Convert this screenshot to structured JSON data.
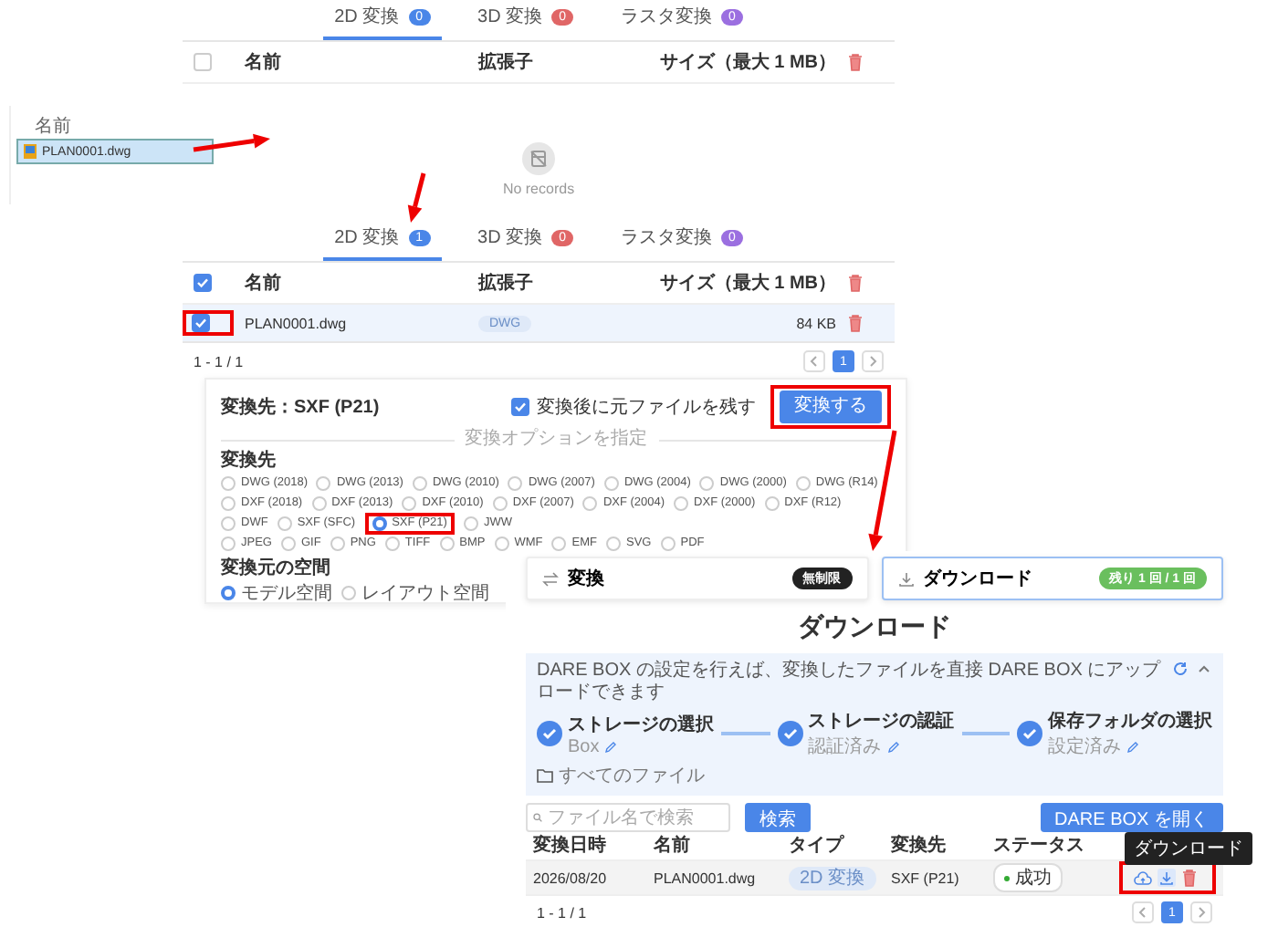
{
  "explorer": {
    "column": "名前",
    "file": "PLAN0001.dwg",
    "selected": true
  },
  "upload_empty": {
    "tabs": [
      {
        "label": "2D 変換",
        "count": "0",
        "color": "#4a86e8",
        "selected": true
      },
      {
        "label": "3D 変換",
        "count": "0",
        "color": "#e06666",
        "selected": false
      },
      {
        "label": "ラスタ変換",
        "count": "0",
        "color": "#9b6fe0",
        "selected": false
      }
    ],
    "header_checked": false,
    "columns": [
      "名前",
      "拡張子",
      "サイズ（最大 1 MB）"
    ],
    "empty_text": "No records"
  },
  "upload_filled": {
    "tabs": [
      {
        "label": "2D 変換",
        "count": "1",
        "color": "#4a86e8",
        "selected": true
      },
      {
        "label": "3D 変換",
        "count": "0",
        "color": "#e06666",
        "selected": false
      },
      {
        "label": "ラスタ変換",
        "count": "0",
        "color": "#9b6fe0",
        "selected": false
      }
    ],
    "header_checked": true,
    "columns": [
      "名前",
      "拡張子",
      "サイズ（最大 1 MB）"
    ],
    "rows": [
      {
        "checked": true,
        "name": "PLAN0001.dwg",
        "ext": "DWG",
        "size": "84 KB"
      }
    ],
    "range": "1 - 1 / 1",
    "pages": [
      {
        "label": "1",
        "selected": true
      }
    ]
  },
  "convert": {
    "title": "変換先：SXF (P21)",
    "keep_original": {
      "label": "変換後に元ファイルを残す",
      "checked": true
    },
    "button": "変換する",
    "divider": "変換オプションを指定",
    "target_label": "変換先",
    "target_rows": [
      {
        "options": [
          {
            "label": "DWG (2018)",
            "selected": false
          },
          {
            "label": "DWG (2013)",
            "selected": false
          },
          {
            "label": "DWG (2010)",
            "selected": false
          },
          {
            "label": "DWG (2007)",
            "selected": false
          },
          {
            "label": "DWG (2004)",
            "selected": false
          },
          {
            "label": "DWG (2000)",
            "selected": false
          },
          {
            "label": "DWG (R14)",
            "selected": false
          }
        ]
      },
      {
        "options": [
          {
            "label": "DXF (2018)",
            "selected": false
          },
          {
            "label": "DXF (2013)",
            "selected": false
          },
          {
            "label": "DXF (2010)",
            "selected": false
          },
          {
            "label": "DXF (2007)",
            "selected": false
          },
          {
            "label": "DXF (2004)",
            "selected": false
          },
          {
            "label": "DXF (2000)",
            "selected": false
          },
          {
            "label": "DXF (R12)",
            "selected": false
          }
        ]
      },
      {
        "options": [
          {
            "label": "DWF",
            "selected": false
          },
          {
            "label": "SXF (SFC)",
            "selected": false
          },
          {
            "label": "SXF (P21)",
            "selected": true
          },
          {
            "label": "JWW",
            "selected": false
          }
        ]
      },
      {
        "options": [
          {
            "label": "JPEG",
            "selected": false
          },
          {
            "label": "GIF",
            "selected": false
          },
          {
            "label": "PNG",
            "selected": false
          },
          {
            "label": "TIFF",
            "selected": false
          },
          {
            "label": "BMP",
            "selected": false
          },
          {
            "label": "WMF",
            "selected": false
          },
          {
            "label": "EMF",
            "selected": false
          },
          {
            "label": "SVG",
            "selected": false
          },
          {
            "label": "PDF",
            "selected": false
          }
        ]
      }
    ],
    "space_label": "変換元の空間",
    "space_options": [
      {
        "label": "モデル空間",
        "selected": true
      },
      {
        "label": "レイアウト空間",
        "selected": false
      }
    ]
  },
  "download": {
    "modes": [
      {
        "label": "変換",
        "badge": "無制限",
        "color": "#222222",
        "selected": false
      },
      {
        "label": "ダウンロード",
        "badge": "残り 1 回 / 1 回",
        "color": "#6abf5e",
        "selected": true
      }
    ],
    "heading": "ダウンロード",
    "dare_box": {
      "message": "DARE BOX の設定を行えば、変換したファイルを直接 DARE BOX にアップロードできます",
      "expanded": true,
      "steps": [
        {
          "title": "ストレージの選択",
          "sub": "Box"
        },
        {
          "title": "ストレージの認証",
          "sub": "認証済み"
        },
        {
          "title": "保存フォルダの選択",
          "sub": "設定済み"
        }
      ],
      "folder": "すべてのファイル"
    },
    "search": {
      "placeholder": "ファイル名で検索"
    },
    "search_button": "検索",
    "open_button": "DARE BOX を開く",
    "columns": [
      "変換日時",
      "名前",
      "タイプ",
      "変換先",
      "ステータス"
    ],
    "rows": [
      {
        "date": "2026/08/20",
        "name": "PLAN0001.dwg",
        "type": "2D 変換",
        "target": "SXF (P21)",
        "status": "成功"
      }
    ],
    "tooltip": "ダウンロード",
    "range": "1 - 1 / 1",
    "pages": [
      {
        "label": "1",
        "selected": true
      }
    ]
  }
}
